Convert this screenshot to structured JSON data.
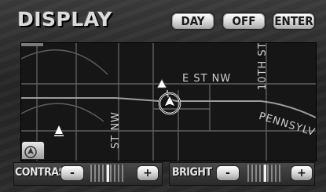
{
  "header": {
    "title": "DISPLAY"
  },
  "buttons": {
    "day": "DAY",
    "off": "OFF",
    "enter": "ENTER"
  },
  "map": {
    "street_labels": {
      "e_st": "E ST NW",
      "tenth_st": "10TH ST",
      "st_nw": "ST NW",
      "pennsylvania": "PENNSYLV"
    }
  },
  "controls": {
    "contrast": {
      "label": "CONTRAST",
      "minus": "-",
      "plus": "+",
      "level": 0.5
    },
    "bright": {
      "label": "BRIGHT",
      "minus": "-",
      "plus": "+",
      "level": 0.5
    }
  }
}
